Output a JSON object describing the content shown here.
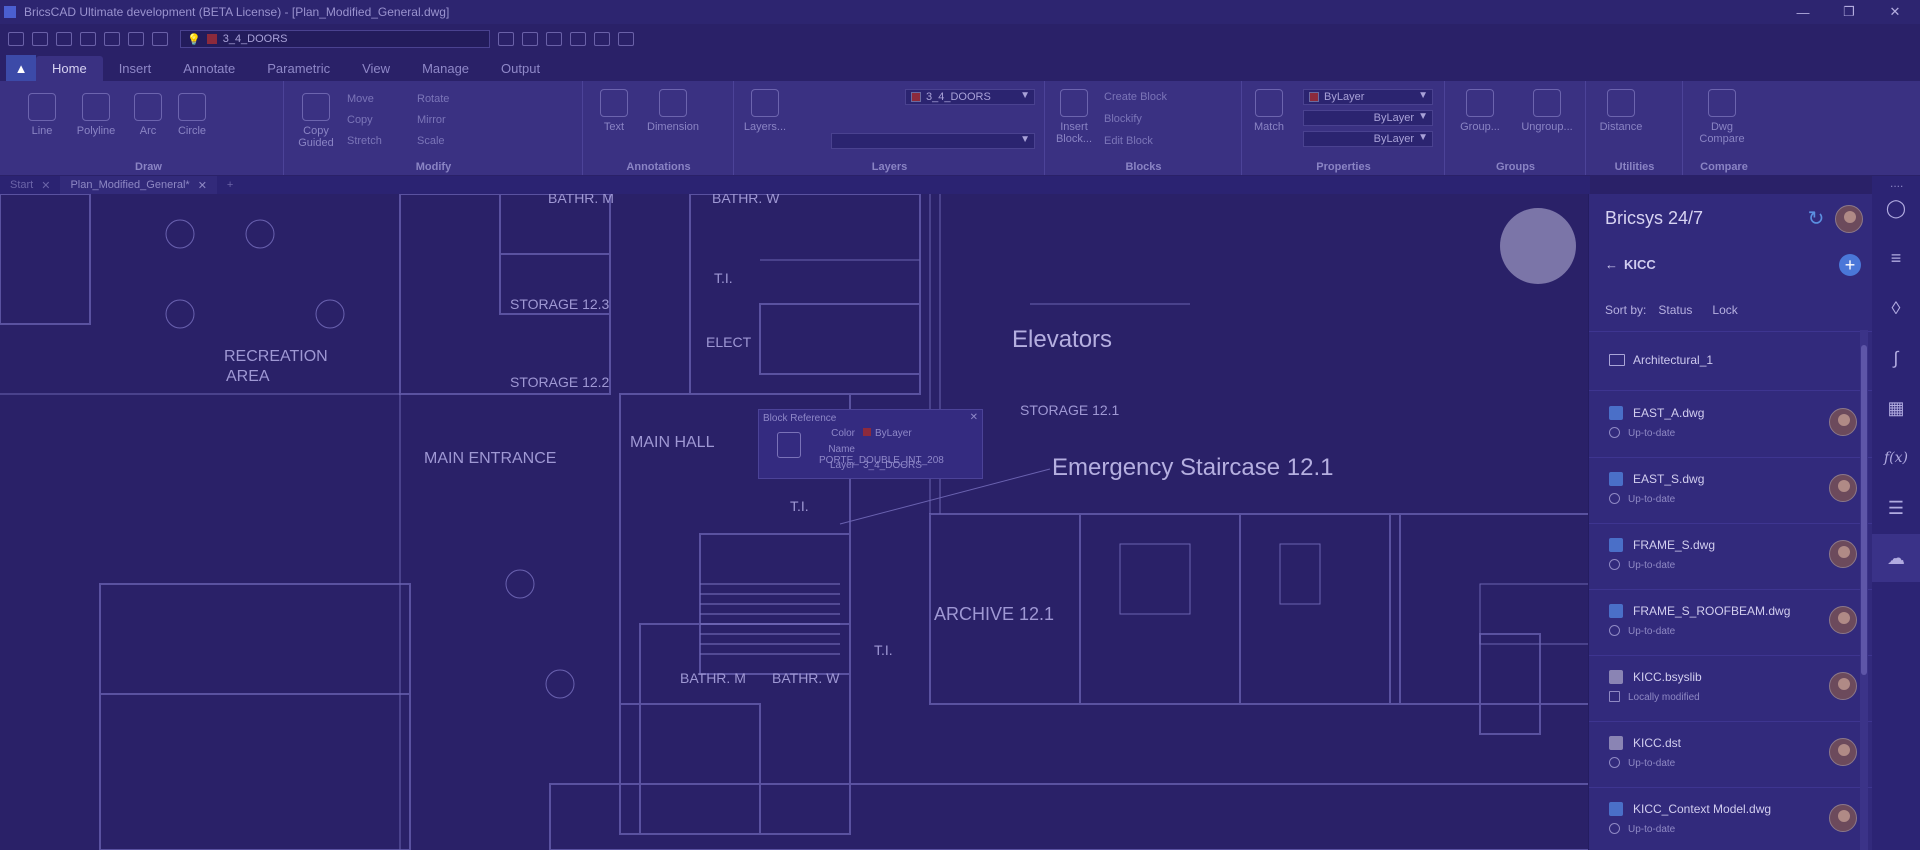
{
  "titlebar": {
    "title": "BricsCAD Ultimate development (BETA License) - [Plan_Modified_General.dwg]",
    "minimize_icon": "minimize-icon",
    "maximize_icon": "restore-icon",
    "close_icon": "close-icon"
  },
  "quick_access": {
    "layer_value": "3_4_DOORS"
  },
  "ribbon_tabs": [
    "Home",
    "Insert",
    "Annotate",
    "Parametric",
    "View",
    "Manage",
    "Output"
  ],
  "ribbon": {
    "draw": {
      "label": "Draw",
      "tools": [
        "Line",
        "Polyline",
        "Arc",
        "Circle"
      ]
    },
    "modify": {
      "label": "Modify",
      "copy_guided": "Copy\nGuided",
      "move": "Move",
      "copy": "Copy",
      "stretch": "Stretch",
      "rotate": "Rotate",
      "mirror": "Mirror",
      "scale": "Scale"
    },
    "annotations": {
      "label": "Annotations",
      "text": "Text",
      "dimension": "Dimension"
    },
    "layers": {
      "label": "Layers",
      "layers_btn": "Layers...",
      "layer_value": "3_4_DOORS"
    },
    "blocks": {
      "label": "Blocks",
      "insert": "Insert\nBlock...",
      "create": "Create Block",
      "blockify": "Blockify",
      "edit": "Edit Block"
    },
    "properties": {
      "label": "Properties",
      "match": "Match",
      "color": "ByLayer",
      "linetype": "ByLayer",
      "lineweight": "ByLayer"
    },
    "groups": {
      "label": "Groups",
      "group": "Group...",
      "ungroup": "Ungroup..."
    },
    "utilities": {
      "label": "Utilities",
      "distance": "Distance"
    },
    "compare": {
      "label": "Compare",
      "dwg_compare": "Dwg\nCompare"
    }
  },
  "doc_tabs": [
    "Start",
    "Plan_Modified_General*"
  ],
  "drawing": {
    "labels": [
      "BATHR. M",
      "BATHR. W",
      "T.I.",
      "STORAGE 12.3",
      "STORAGE 12.2",
      "ELECT",
      "RECREATION",
      "AREA",
      "MAIN HALL",
      "MAIN ENTRANCE",
      "STORAGE 12.1",
      "T.I.",
      "ARCHIVE 12.1",
      "BATHR. M",
      "BATHR. W",
      "T.I."
    ],
    "big_labels": [
      "Elevators",
      "Emergency Staircase 12.1"
    ],
    "block_reference": {
      "header": "Block Reference",
      "color_label": "Color",
      "color_value": "ByLayer",
      "name_label": "Name",
      "name_value": "PORTE_DOUBLE_INT_208",
      "layer_label": "Layer",
      "layer_value": "3_4_DOORS"
    }
  },
  "panel": {
    "title": "Bricsys 24/7",
    "back_label": "KICC",
    "sort_by": "Sort by:",
    "sort_status": "Status",
    "sort_lock": "Lock",
    "folder": "Architectural_1",
    "files": [
      {
        "name": "EAST_A.dwg",
        "status": "Up-to-date",
        "type": "dwg"
      },
      {
        "name": "EAST_S.dwg",
        "status": "Up-to-date",
        "type": "dwg"
      },
      {
        "name": "FRAME_S.dwg",
        "status": "Up-to-date",
        "type": "dwg"
      },
      {
        "name": "FRAME_S_ROOFBEAM.dwg",
        "status": "Up-to-date",
        "type": "dwg"
      },
      {
        "name": "KICC.bsyslib",
        "status": "Locally modified",
        "type": "file"
      },
      {
        "name": "KICC.dst",
        "status": "Up-to-date",
        "type": "file"
      },
      {
        "name": "KICC_Context Model.dwg",
        "status": "Up-to-date",
        "type": "dwg"
      }
    ]
  },
  "right_strip": [
    "lightbulb-icon",
    "sliders-icon",
    "layers-icon",
    "attachment-icon",
    "hatch-icon",
    "function-icon",
    "structure-icon",
    "cloud-upload-icon"
  ],
  "colors": {
    "accent": "#4a77d8",
    "background": "#2a2168",
    "layer_swatch": "#8c2a3c"
  }
}
